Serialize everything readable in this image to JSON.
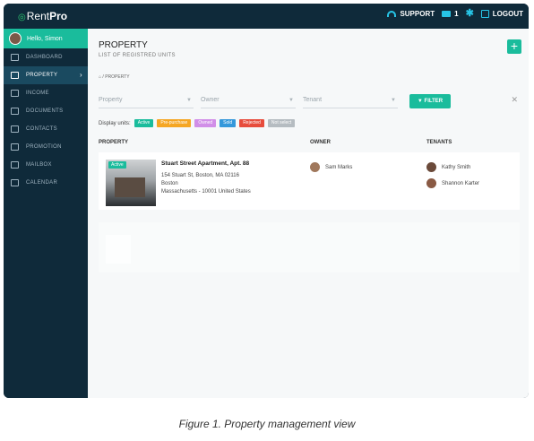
{
  "topbar": {
    "logo_prefix": "Rent",
    "logo_bold": "Pro",
    "support_label": "SUPPORT",
    "mail_count": "1",
    "logout_label": "LOGOUT"
  },
  "sidebar": {
    "greeting": "Hello, Simon",
    "items": [
      {
        "label": "DASHBOARD",
        "icon": "dashboard-icon"
      },
      {
        "label": "PROPERTY",
        "icon": "list-icon",
        "active": true
      },
      {
        "label": "INCOME",
        "icon": "card-icon"
      },
      {
        "label": "DOCUMENTS",
        "icon": "document-icon"
      },
      {
        "label": "CONTACTS",
        "icon": "contacts-icon"
      },
      {
        "label": "PROMOTION",
        "icon": "megaphone-icon"
      },
      {
        "label": "MAILBOX",
        "icon": "mail-icon"
      },
      {
        "label": "CALENDAR",
        "icon": "calendar-icon"
      }
    ]
  },
  "main": {
    "title": "PROPERTY",
    "subtitle": "LIST OF REGISTRED UNITS",
    "breadcrumb": "PROPERTY",
    "filters": {
      "property_placeholder": "Property",
      "owner_placeholder": "Owner",
      "tenant_placeholder": "Tenant",
      "filter_button": "FILTER"
    },
    "display_units_label": "Display units:",
    "chips": [
      {
        "label": "Active",
        "color": "#1abc9c"
      },
      {
        "label": "Pre-purchase",
        "color": "#f5a623"
      },
      {
        "label": "Owned",
        "color": "#d18ee8"
      },
      {
        "label": "Sold",
        "color": "#3498db"
      },
      {
        "label": "Rejected",
        "color": "#e74c3c"
      },
      {
        "label": "Not select",
        "color": "#b5bcc1"
      }
    ],
    "columns": [
      "PROPERTY",
      "OWNER",
      "TENANTS"
    ],
    "row": {
      "status": "Active",
      "name": "Stuart Street Apartment, Apt. 88",
      "address_line1": "154 Stuart St, Boston, MA 02116",
      "address_line2": "Boston",
      "address_line3": "Massachusetts - 10001 United States",
      "owner": "Sam Marks",
      "tenants": [
        "Kathy Smith",
        "Shannon Karter"
      ]
    }
  },
  "caption": "Figure 1. Property management view"
}
